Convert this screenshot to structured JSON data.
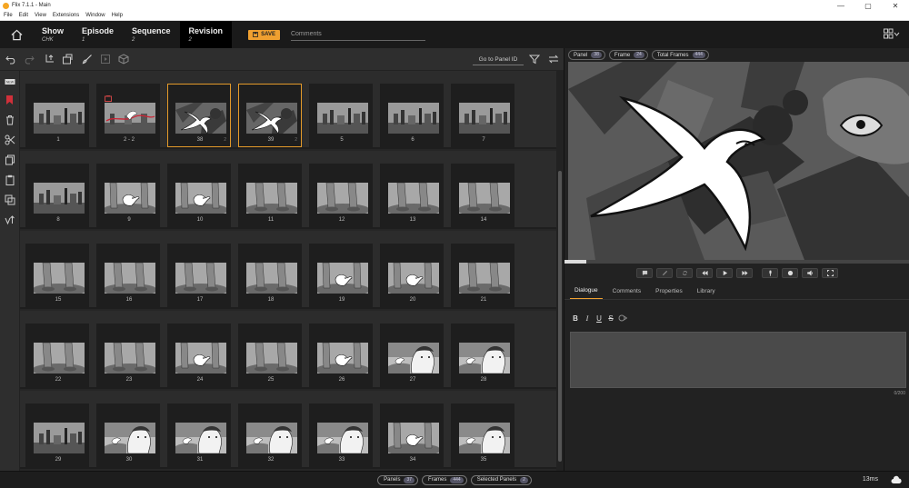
{
  "window": {
    "title": "Flix 7.1.1 - Main",
    "min": "—",
    "max": "▢",
    "close": "✕"
  },
  "menu": [
    "File",
    "Edit",
    "View",
    "Extensions",
    "Window",
    "Help"
  ],
  "header": {
    "crumbs": [
      {
        "label": "Show",
        "value": "CHK"
      },
      {
        "label": "Episode",
        "value": "1"
      },
      {
        "label": "Sequence",
        "value": "2"
      },
      {
        "label": "Revision",
        "value": "2"
      }
    ],
    "save_label": "SAVE",
    "comments_placeholder": "Comments"
  },
  "toolbar": {
    "goto_placeholder": "Go to Panel ID"
  },
  "rows": [
    [
      {
        "n": "1",
        "v": "",
        "s": false,
        "f": false,
        "k": "city"
      },
      {
        "n": "2 - 2",
        "v": "",
        "s": false,
        "f": true,
        "k": "city-red"
      },
      {
        "n": "38",
        "v": "2",
        "s": true,
        "f": false,
        "k": "bird-fly"
      },
      {
        "n": "39",
        "v": "2",
        "s": true,
        "f": false,
        "k": "bird-fly"
      },
      {
        "n": "5",
        "v": "",
        "s": false,
        "f": false,
        "k": "city"
      },
      {
        "n": "6",
        "v": "",
        "s": false,
        "f": false,
        "k": "city"
      },
      {
        "n": "7",
        "v": "",
        "s": false,
        "f": false,
        "k": "city"
      }
    ],
    [
      {
        "n": "8",
        "v": "",
        "s": false,
        "f": false,
        "k": "city"
      },
      {
        "n": "9",
        "v": "",
        "s": false,
        "f": false,
        "k": "bird-legs"
      },
      {
        "n": "10",
        "v": "",
        "s": false,
        "f": false,
        "k": "bird-legs"
      },
      {
        "n": "11",
        "v": "",
        "s": false,
        "f": false,
        "k": "legs"
      },
      {
        "n": "12",
        "v": "",
        "s": false,
        "f": false,
        "k": "legs"
      },
      {
        "n": "13",
        "v": "",
        "s": false,
        "f": false,
        "k": "legs"
      },
      {
        "n": "14",
        "v": "",
        "s": false,
        "f": false,
        "k": "legs"
      }
    ],
    [
      {
        "n": "15",
        "v": "",
        "s": false,
        "f": false,
        "k": "legs"
      },
      {
        "n": "16",
        "v": "",
        "s": false,
        "f": false,
        "k": "legs"
      },
      {
        "n": "17",
        "v": "",
        "s": false,
        "f": false,
        "k": "legs"
      },
      {
        "n": "18",
        "v": "",
        "s": false,
        "f": false,
        "k": "legs"
      },
      {
        "n": "19",
        "v": "",
        "s": false,
        "f": false,
        "k": "bird-legs"
      },
      {
        "n": "20",
        "v": "",
        "s": false,
        "f": false,
        "k": "bird-legs"
      },
      {
        "n": "21",
        "v": "",
        "s": false,
        "f": false,
        "k": "legs"
      }
    ],
    [
      {
        "n": "22",
        "v": "",
        "s": false,
        "f": false,
        "k": "legs"
      },
      {
        "n": "23",
        "v": "",
        "s": false,
        "f": false,
        "k": "legs"
      },
      {
        "n": "24",
        "v": "",
        "s": false,
        "f": false,
        "k": "bird-legs"
      },
      {
        "n": "25",
        "v": "",
        "s": false,
        "f": false,
        "k": "legs"
      },
      {
        "n": "26",
        "v": "",
        "s": false,
        "f": false,
        "k": "bird-legs"
      },
      {
        "n": "27",
        "v": "",
        "s": false,
        "f": false,
        "k": "face"
      },
      {
        "n": "28",
        "v": "",
        "s": false,
        "f": false,
        "k": "face"
      }
    ],
    [
      {
        "n": "29",
        "v": "",
        "s": false,
        "f": false,
        "k": "city"
      },
      {
        "n": "30",
        "v": "",
        "s": false,
        "f": false,
        "k": "face"
      },
      {
        "n": "31",
        "v": "",
        "s": false,
        "f": false,
        "k": "face"
      },
      {
        "n": "32",
        "v": "",
        "s": false,
        "f": false,
        "k": "face"
      },
      {
        "n": "33",
        "v": "",
        "s": false,
        "f": false,
        "k": "face"
      },
      {
        "n": "34",
        "v": "",
        "s": false,
        "f": false,
        "k": "bird-legs"
      },
      {
        "n": "35",
        "v": "",
        "s": false,
        "f": false,
        "k": "face"
      }
    ]
  ],
  "info": {
    "panel_label": "Panel",
    "panel_value": "38",
    "frame_label": "Frame",
    "frame_value": "24",
    "total_label": "Total Frames",
    "total_value": "444"
  },
  "tabs": [
    "Dialogue",
    "Comments",
    "Properties",
    "Library"
  ],
  "editor": {
    "bold": "B",
    "italic": "I",
    "underline": "U",
    "strike": "S",
    "count": "0/200"
  },
  "status": {
    "panels_label": "Panels",
    "panels_value": "37",
    "frames_label": "Frames",
    "frames_value": "444",
    "selected_label": "Selected Panels",
    "selected_value": "2",
    "latency": "13ms"
  },
  "colors": {
    "accent": "#f0a030",
    "selected_border": "#e39a2a"
  }
}
